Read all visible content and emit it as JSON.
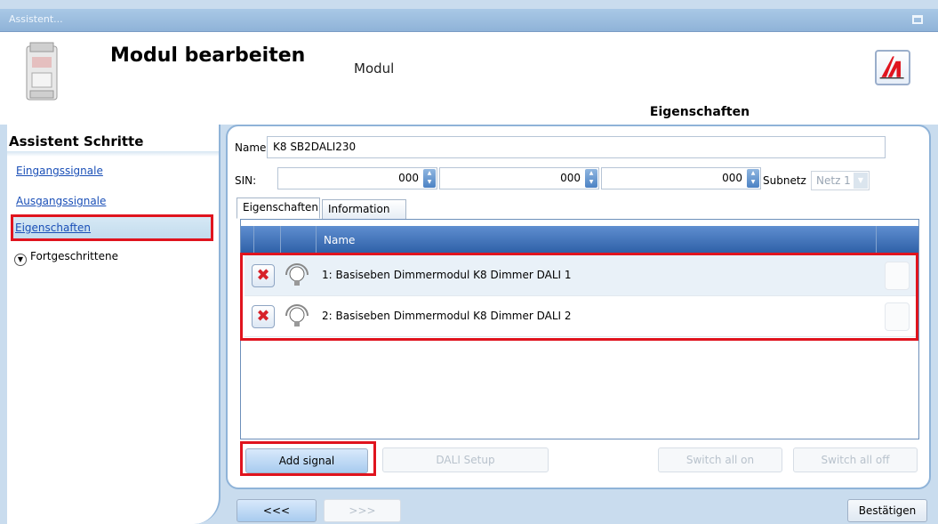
{
  "window": {
    "title": "Assistent..."
  },
  "header": {
    "title": "Modul bearbeiten",
    "subtitle": "Modul",
    "section_tab": "Eigenschaften"
  },
  "sidebar": {
    "title": "Assistent Schritte",
    "items": [
      {
        "label": "Eingangssignale"
      },
      {
        "label": "Ausgangssignale"
      },
      {
        "label": "Eigenschaften",
        "selected": true
      }
    ],
    "advanced_label": "Fortgeschrittene"
  },
  "form": {
    "name_label": "Name",
    "name_value": "K8 SB2DALI230",
    "sin_label": "SIN:",
    "sin_values": [
      "000",
      "000",
      "000"
    ],
    "subnet_label": "Subnetz",
    "subnet_value": "Netz 1"
  },
  "tabs": [
    {
      "label": "Eigenschaften",
      "active": true
    },
    {
      "label": "Information"
    }
  ],
  "grid": {
    "header": "Name",
    "rows": [
      {
        "name": "1: Basiseben Dimmermodul K8 Dimmer DALI 1"
      },
      {
        "name": "2: Basiseben Dimmermodul K8 Dimmer DALI 2"
      }
    ]
  },
  "actions": {
    "add_signal": "Add signal",
    "dali_setup": "DALI Setup",
    "switch_all_on": "Switch all on",
    "switch_all_off": "Switch all off"
  },
  "nav": {
    "back": "<<<",
    "forward": ">>>",
    "confirm": "Bestätigen"
  },
  "colors": {
    "highlight": "#e0141e",
    "grid_header": "#2f61a8",
    "link": "#1a4fb7"
  }
}
